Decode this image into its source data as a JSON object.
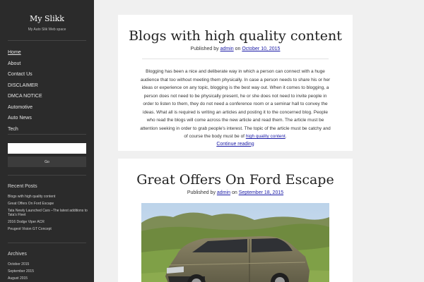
{
  "site": {
    "title": "My Slikk",
    "description": "My Auto Slik Web space"
  },
  "nav": [
    {
      "label": "Home",
      "active": true
    },
    {
      "label": "About"
    },
    {
      "label": "Contact Us"
    },
    {
      "label": "DISCLAIMER"
    },
    {
      "label": "DMCA NOTICE"
    },
    {
      "label": "Automotive"
    },
    {
      "label": "Auto News"
    },
    {
      "label": "Tech"
    }
  ],
  "search": {
    "placeholder": "",
    "button_label": "Go"
  },
  "recent_posts": {
    "title": "Recent Posts",
    "items": [
      "Blogs with high quality content",
      "Great Offers On Ford Escape",
      "Tata Newly Launched Cars –The latest additions to Tata's Fleet",
      "2016 Dodge Viper ACR",
      "Peugeot Vision GT Concept"
    ]
  },
  "archives": {
    "title": "Archives",
    "items": [
      "October 2015",
      "September 2015",
      "August 2015"
    ]
  },
  "posts": [
    {
      "title": "Blogs with high quality content",
      "published_by": "Published by",
      "author": "admin",
      "on": "on",
      "date": "October 10, 2015",
      "body_text": "Blogging has been a nice and deliberate way in which a person can connect with a huge audience that too without meeting them physically. In case a person needs to share his or her ideas or experience on any topic, blogging is the best way out. When it comes to blogging, a person does not need to be physically present, he or she does not need to invite people in order to listen to them, they do not need a conference room or a seminar hall to convey the ideas. What all is required is writing an articles and posting it to the concerned blog. People who read the blogs will come across the new article and read them. The article must be attention seeking in order to grab people's interest. The topic of the article must be catchy and of course the body must be of ",
      "body_link": "high quality content",
      "body_end": ".",
      "continue_label": "Continue reading"
    },
    {
      "title": "Great Offers On Ford Escape",
      "published_by": "Published by",
      "author": "admin",
      "on": "on",
      "date": "September 18, 2015"
    }
  ],
  "colors": {
    "sidebar_bg": "#2b2b2b",
    "page_bg": "#f0f0f0",
    "link": "#1a1aa6"
  }
}
